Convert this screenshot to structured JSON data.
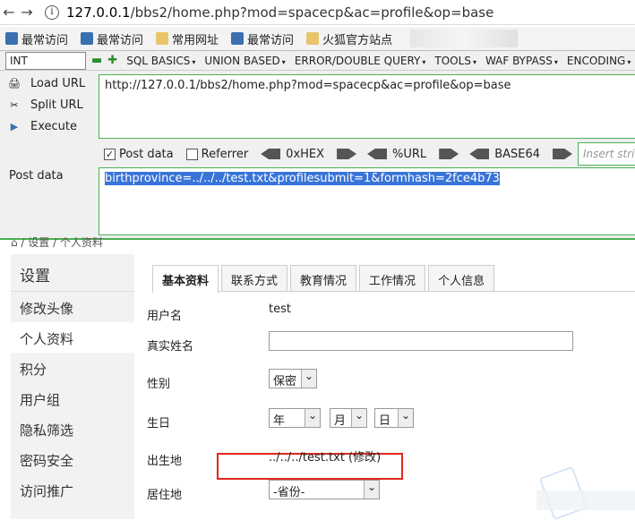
{
  "browser": {
    "url_host": "127.0.0.1",
    "url_path": "/bbs2/home.php?mod=spacecp&ac=profile&op=base",
    "bookmarks": [
      "最常访问",
      "最常访问",
      "常用网址",
      "最常访问",
      "火狐官方站点"
    ]
  },
  "hackbar": {
    "type_select": "INT",
    "menus": [
      "SQL BASICS",
      "UNION BASED",
      "ERROR/DOUBLE QUERY",
      "TOOLS",
      "WAF BYPASS",
      "ENCODING"
    ],
    "load_url": "Load URL",
    "split_url": "Split URL",
    "execute": "Execute",
    "url_value": "http://127.0.0.1/bbs2/home.php?mod=spacecp&ac=profile&op=base",
    "post_data_checked": "Post data",
    "referrer": "Referrer",
    "hex": "0xHEX",
    "urlenc": "%URL",
    "base64": "BASE64",
    "insert_placeholder": "Insert strin",
    "post_label": "Post data",
    "post_value": "birthprovince=../../../test.txt&profilesubmit=1&formhash=2fce4b73"
  },
  "page": {
    "breadcrumb": "⌂ / 设置 / 个人资料",
    "sidebar_title": "设置",
    "sidebar_items": [
      "修改头像",
      "个人资料",
      "积分",
      "用户组",
      "隐私筛选",
      "密码安全",
      "访问推广"
    ],
    "tabs": [
      "基本资料",
      "联系方式",
      "教育情况",
      "工作情况",
      "个人信息"
    ],
    "fields": {
      "username_label": "用户名",
      "username_value": "test",
      "realname_label": "真实姓名",
      "gender_label": "性别",
      "gender_value": "保密",
      "birthday_label": "生日",
      "year": "年",
      "month": "月",
      "day": "日",
      "birthplace_label": "出生地",
      "birthplace_value": "../../../test.txt (修改)",
      "residence_label": "居住地",
      "residence_value": "-省份-"
    }
  }
}
